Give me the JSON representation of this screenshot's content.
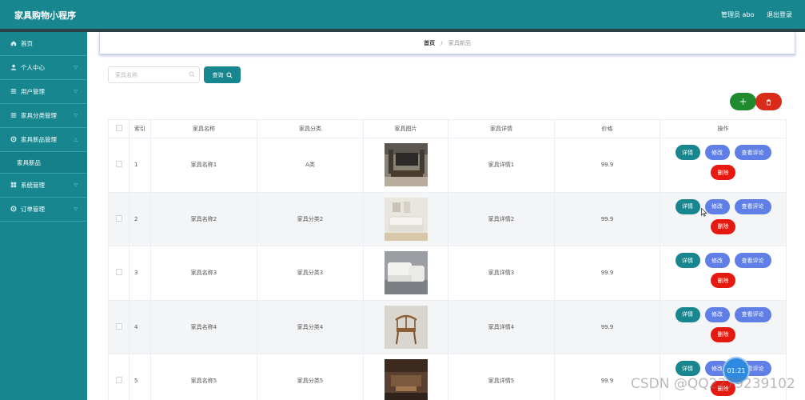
{
  "header": {
    "app_title": "家具购物小程序",
    "admin": "管理员 abo",
    "logout": "退出登录"
  },
  "sidebar": {
    "items": [
      {
        "label": "首页",
        "icon": "home-icon",
        "has_children": false
      },
      {
        "label": "个人中心",
        "icon": "user-icon",
        "has_children": true
      },
      {
        "label": "用户管理",
        "icon": "list-icon",
        "has_children": true
      },
      {
        "label": "家具分类管理",
        "icon": "list-icon",
        "has_children": true
      },
      {
        "label": "家具新品管理",
        "icon": "gear-icon",
        "has_children": true,
        "expanded": true,
        "children": [
          "家具新品"
        ]
      },
      {
        "label": "系统管理",
        "icon": "grid-icon",
        "has_children": true
      },
      {
        "label": "订单管理",
        "icon": "gear-icon",
        "has_children": true
      }
    ]
  },
  "breadcrumb": {
    "home": "首页",
    "separator": "/",
    "current": "家具新品"
  },
  "search": {
    "placeholder": "家具名称",
    "button": "查询"
  },
  "actions": {
    "add": "+",
    "delete_icon": "trash-icon"
  },
  "table": {
    "columns": [
      "索引",
      "家具名称",
      "家具分类",
      "家具图片",
      "家具详情",
      "价格",
      "操作"
    ],
    "rows": [
      {
        "index": "1",
        "name": "家具名称1",
        "category": "A类",
        "detail": "家具详情1",
        "price": "99.9"
      },
      {
        "index": "2",
        "name": "家具名称2",
        "category": "家具分类2",
        "detail": "家具详情2",
        "price": "99.9"
      },
      {
        "index": "3",
        "name": "家具名称3",
        "category": "家具分类3",
        "detail": "家具详情3",
        "price": "99.9"
      },
      {
        "index": "4",
        "name": "家具名称4",
        "category": "家具分类4",
        "detail": "家具详情4",
        "price": "99.9"
      },
      {
        "index": "5",
        "name": "家具名称5",
        "category": "家具分类5",
        "detail": "家具详情5",
        "price": "99.9"
      }
    ],
    "ops": {
      "detail": "详情",
      "edit": "修改",
      "review": "查看评论",
      "delete": "删除"
    }
  },
  "overlay": {
    "timer": "01:21",
    "watermark": "CSDN @QQ2279239102"
  },
  "colors": {
    "primary": "#17868f",
    "blue": "#5f7fe6",
    "red": "#e5190f",
    "green": "#1f8a2e"
  }
}
